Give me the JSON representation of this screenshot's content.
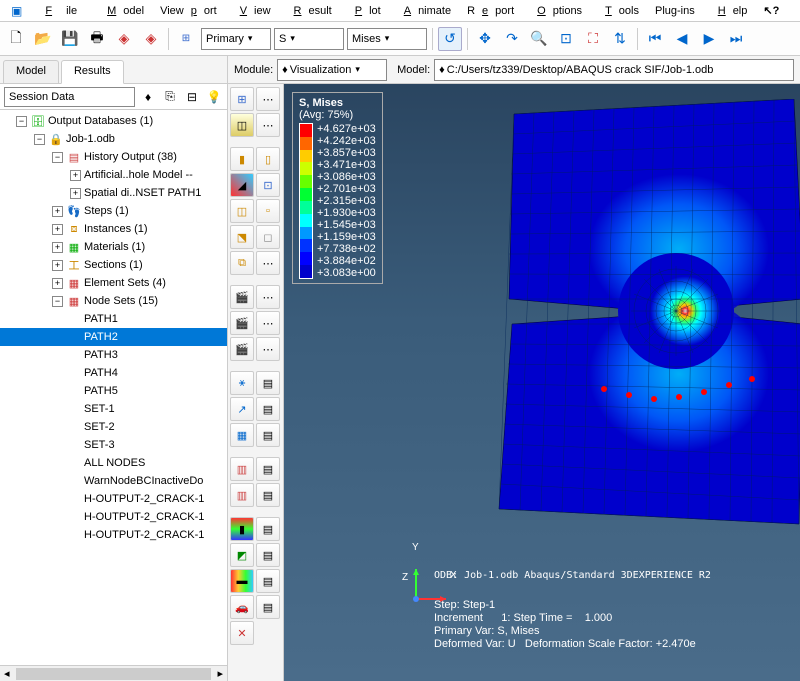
{
  "menu": {
    "file": "File",
    "model": "Model",
    "viewport": "Viewport",
    "view": "View",
    "result": "Result",
    "plot": "Plot",
    "animate": "Animate",
    "report": "Report",
    "options": "Options",
    "tools": "Tools",
    "plugins": "Plug-ins",
    "help": "Help",
    "whats": "⁇"
  },
  "toolbar": {
    "combo1": "Primary",
    "combo2": "S",
    "combo3": "Mises"
  },
  "tabs": {
    "model": "Model",
    "results": "Results"
  },
  "session": {
    "label": "Session Data"
  },
  "tree": {
    "root": "Output Databases (1)",
    "job": "Job-1.odb",
    "history": "History Output (38)",
    "artificial": "Artificial..hole Model --",
    "spatial": "Spatial di..NSET PATH1",
    "steps": "Steps (1)",
    "instances": "Instances (1)",
    "materials": "Materials (1)",
    "sections": "Sections (1)",
    "elemsets": "Element Sets (4)",
    "nodesets": "Node Sets (15)",
    "nodes": [
      "PATH1",
      "PATH2",
      "PATH3",
      "PATH4",
      "PATH5",
      "SET-1",
      "SET-2",
      "SET-3",
      "ALL NODES",
      "WarnNodeBCInactiveDo",
      "H-OUTPUT-2_CRACK-1",
      "H-OUTPUT-2_CRACK-1",
      "H-OUTPUT-2_CRACK-1"
    ]
  },
  "context": {
    "module_lbl": "Module:",
    "module_val": "Visualization",
    "model_lbl": "Model:",
    "model_val": "C:/Users/tz339/Desktop/ABAQUS crack SIF/Job-1.odb"
  },
  "legend": {
    "title": "S, Mises",
    "avg": "(Avg: 75%)",
    "vals": [
      "+4.627e+03",
      "+4.242e+03",
      "+3.857e+03",
      "+3.471e+03",
      "+3.086e+03",
      "+2.701e+03",
      "+2.315e+03",
      "+1.930e+03",
      "+1.545e+03",
      "+1.159e+03",
      "+7.738e+02",
      "+3.884e+02",
      "+3.083e+00"
    ]
  },
  "triad": {
    "x": "X",
    "y": "Y",
    "z": "Z"
  },
  "info": {
    "odb": "ODB: Job-1.odb    Abaqus/Standard 3DEXPERIENCE R2",
    "step": "Step: Step-1",
    "incr": "Increment      1: Step Time =    1.000",
    "primary": "Primary Var: S, Mises",
    "deformed": "Deformed Var: U   Deformation Scale Factor: +2.470e"
  }
}
